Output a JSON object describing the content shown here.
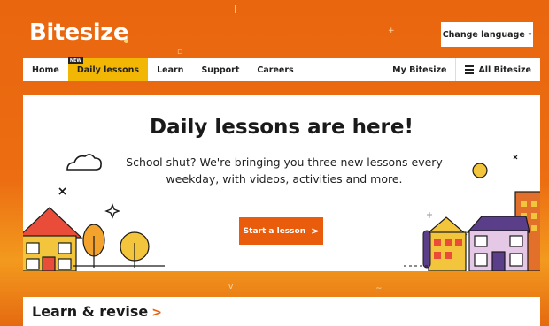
{
  "brand": {
    "logo": "Bitesize"
  },
  "header": {
    "language_button": "Change language",
    "language_caret": "▾"
  },
  "nav": {
    "items": [
      {
        "label": "Home"
      },
      {
        "label": "Daily lessons",
        "badge": "NEW",
        "active": true
      },
      {
        "label": "Learn"
      },
      {
        "label": "Support"
      },
      {
        "label": "Careers"
      }
    ],
    "my_bitesize": "My Bitesize",
    "all_bitesize": "All Bitesize"
  },
  "hero": {
    "title": "Daily lessons are here!",
    "text": "School shut? We're bringing you three new lessons every weekday, with videos, activities and more.",
    "cta_label": "Start a lesson",
    "cta_arrow": ">"
  },
  "section": {
    "title": "Learn & revise",
    "chevron": ">"
  },
  "colors": {
    "orange": "#e9660f",
    "accent_yellow": "#f2b705",
    "cta": "#e95c0c"
  },
  "icons": [
    "caret-down-icon",
    "menu-icon",
    "cloud-icon",
    "sparkle-icon",
    "house-icon",
    "tree-icon",
    "sun-icon",
    "chevron-right-icon"
  ]
}
